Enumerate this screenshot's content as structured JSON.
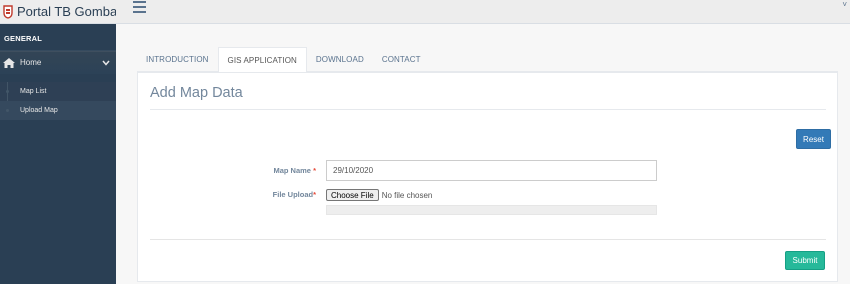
{
  "brand": {
    "title": "Portal TB Gombak",
    "logo_icon": "shield-logo-icon"
  },
  "sidebar": {
    "section_title": "GENERAL",
    "home_label": "Home",
    "items": [
      {
        "label": "Map List",
        "active": false
      },
      {
        "label": "Upload Map",
        "active": true
      }
    ]
  },
  "topnav": {
    "menu_icon": "hamburger-icon",
    "user_caret": "˅"
  },
  "tabs": [
    {
      "label": "INTRODUCTION",
      "active": false
    },
    {
      "label": "GIS APPLICATION",
      "active": true
    },
    {
      "label": "DOWNLOAD",
      "active": false
    },
    {
      "label": "CONTACT",
      "active": false
    }
  ],
  "panel": {
    "title": "Add Map Data",
    "reset_label": "Reset",
    "submit_label": "Submit",
    "form": {
      "map_name_label": "Map Name",
      "map_name_required": "*",
      "map_name_value": "29/10/2020",
      "file_upload_label": "File Upload",
      "file_upload_required": "*",
      "file_button_label": "Choose File",
      "file_status": "No file chosen"
    }
  },
  "colors": {
    "sidebar": "#2a3f54",
    "primary": "#337ab7",
    "success": "#26b99a"
  }
}
